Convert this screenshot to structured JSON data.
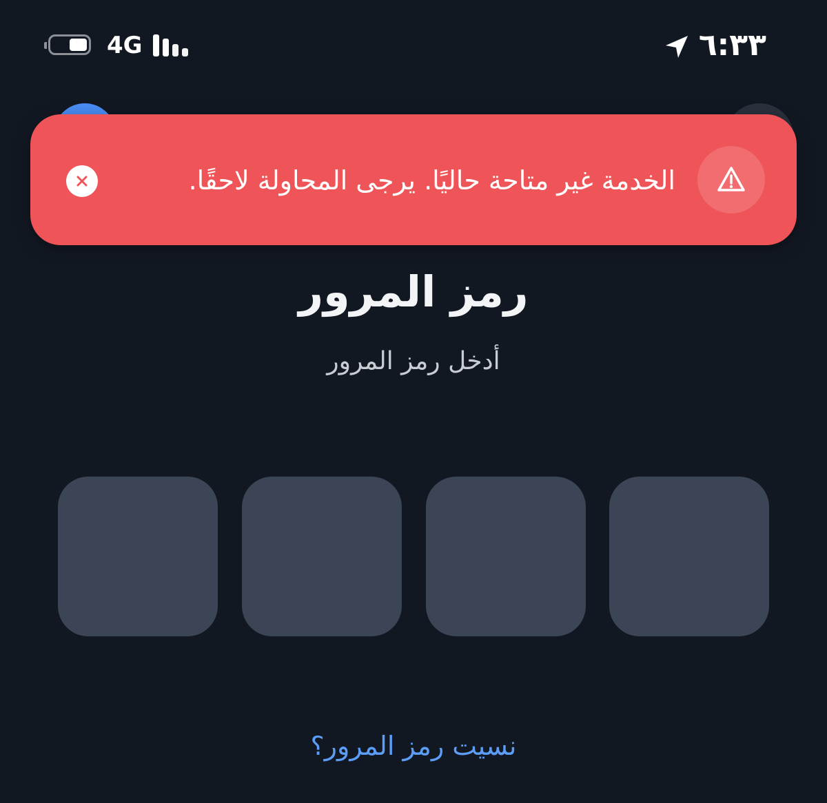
{
  "status_bar": {
    "time": "٦:٣٣",
    "network": "4G",
    "battery_level": 0.5,
    "signal_bars_active": 2,
    "signal_bars_total": 4,
    "icons": {
      "battery": "battery-icon",
      "signal": "signal-icon",
      "location": "location-arrow-icon"
    }
  },
  "toast": {
    "type": "error",
    "message": "الخدمة غير متاحة حاليًا. يرجى المحاولة لاحقًا.",
    "icon": "warning-triangle-icon",
    "close_icon": "close-icon",
    "background_color": "#ef5558"
  },
  "passcode": {
    "title": "رمز المرور",
    "subtitle": "أدخل رمز المرور",
    "digit_count": 4,
    "digits": [
      "",
      "",
      "",
      ""
    ],
    "forgot_link": "نسيت رمز المرور؟"
  },
  "colors": {
    "background": "#121822",
    "pin_box": "#3c4555",
    "link": "#5b9df7",
    "accent_avatar": "#4a8df5"
  }
}
